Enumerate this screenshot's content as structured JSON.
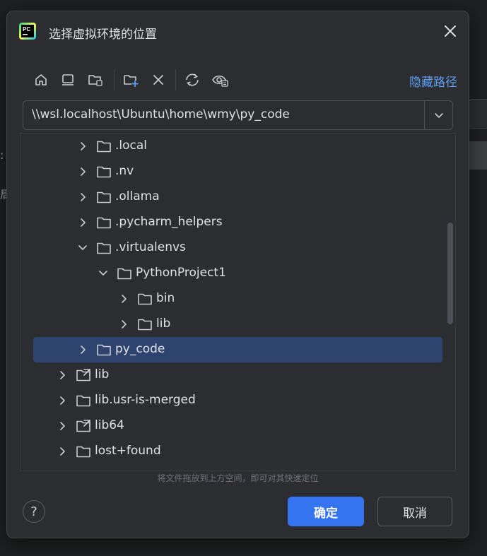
{
  "dialog": {
    "title": "选择虚拟环境的位置",
    "hide_path_label": "隐藏路径",
    "path_value": "\\\\wsl.localhost\\Ubuntu\\home\\wmy\\py_code",
    "hint": "将文件拖放到上方空间，即可对其快速定位",
    "ok_label": "确定",
    "cancel_label": "取消",
    "help_label": "?"
  },
  "toolbar": {
    "icons": [
      "home-icon",
      "desktop-icon",
      "project-folder-icon",
      "new-folder-icon",
      "delete-icon",
      "refresh-icon",
      "show-hidden-icon"
    ]
  },
  "tree": {
    "items": [
      {
        "label": ".local",
        "expanded": false,
        "icon": "folder-icon"
      },
      {
        "label": ".nv",
        "expanded": false,
        "icon": "folder-icon"
      },
      {
        "label": ".ollama",
        "expanded": false,
        "icon": "folder-icon"
      },
      {
        "label": ".pycharm_helpers",
        "expanded": false,
        "icon": "folder-icon"
      },
      {
        "label": ".virtualenvs",
        "expanded": true,
        "icon": "folder-icon"
      },
      {
        "label": "PythonProject1",
        "expanded": true,
        "icon": "folder-icon"
      },
      {
        "label": "bin",
        "expanded": false,
        "icon": "folder-icon"
      },
      {
        "label": "lib",
        "expanded": false,
        "icon": "folder-icon"
      },
      {
        "label": "py_code",
        "expanded": false,
        "icon": "folder-icon",
        "selected": true
      },
      {
        "label": "lib",
        "expanded": false,
        "icon": "symlink-folder-icon"
      },
      {
        "label": "lib.usr-is-merged",
        "expanded": false,
        "icon": "folder-icon"
      },
      {
        "label": "lib64",
        "expanded": false,
        "icon": "symlink-folder-icon"
      },
      {
        "label": "lost+found",
        "expanded": false,
        "icon": "folder-icon"
      }
    ]
  },
  "colors": {
    "accent": "#3574f0",
    "link": "#5e9ef5",
    "selection": "#2e436e",
    "background": "#2b2d30"
  }
}
